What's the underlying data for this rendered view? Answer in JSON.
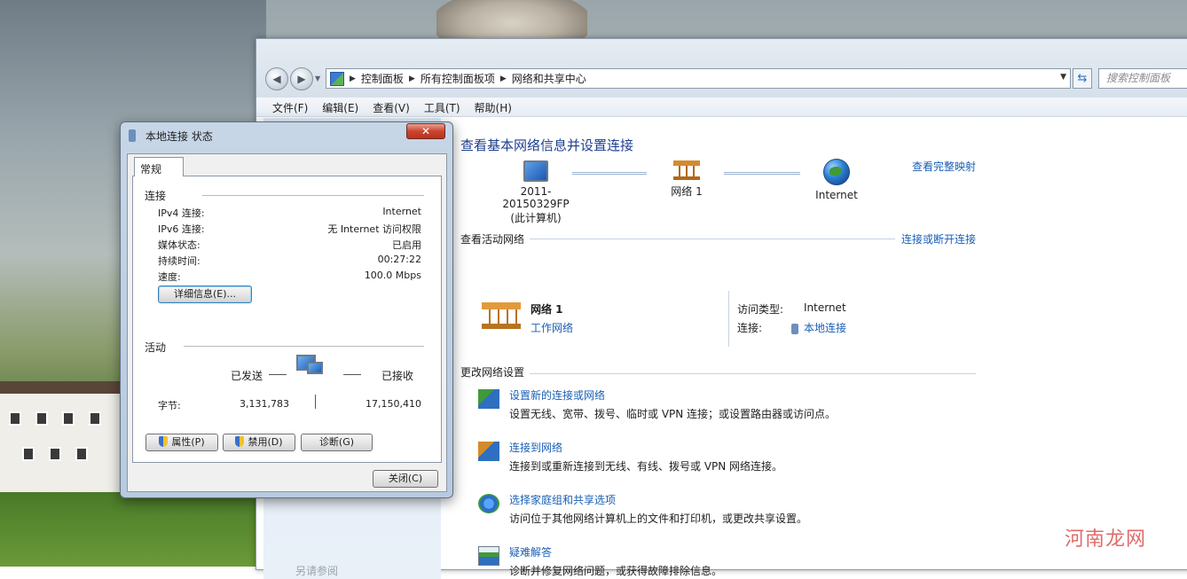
{
  "explorer": {
    "address": {
      "crumbs": [
        "控制面板",
        "所有控制面板项",
        "网络和共享中心"
      ],
      "search_placeholder": "搜索控制面板"
    },
    "menu": [
      "文件(F)",
      "编辑(E)",
      "查看(V)",
      "工具(T)",
      "帮助(H)"
    ],
    "left_pane_bottom": "另请参阅",
    "main": {
      "title": "查看基本网络信息并设置连接",
      "map_link": "查看完整映射",
      "nodes": {
        "computer_name": "2011-20150329FP",
        "computer_sub": "(此计算机)",
        "network": "网络 1",
        "internet": "Internet"
      },
      "active_networks": {
        "heading": "查看活动网络",
        "connect_link": "连接或断开连接",
        "network_name": "网络 1",
        "network_type": "工作网络",
        "access_type_label": "访问类型:",
        "access_type_value": "Internet",
        "connections_label": "连接:",
        "connections_value": "本地连接"
      },
      "change_settings": {
        "heading": "更改网络设置",
        "tasks": [
          {
            "title": "设置新的连接或网络",
            "desc": "设置无线、宽带、拨号、临时或 VPN 连接；或设置路由器或访问点。"
          },
          {
            "title": "连接到网络",
            "desc": "连接到或重新连接到无线、有线、拨号或 VPN 网络连接。"
          },
          {
            "title": "选择家庭组和共享选项",
            "desc": "访问位于其他网络计算机上的文件和打印机，或更改共享设置。"
          },
          {
            "title": "疑难解答",
            "desc": "诊断并修复网络问题，或获得故障排除信息。"
          }
        ]
      }
    }
  },
  "dialog": {
    "title": "本地连接 状态",
    "close_glyph": "✕",
    "tab": "常规",
    "connection": {
      "heading": "连接",
      "rows": [
        {
          "label": "IPv4 连接:",
          "value": "Internet"
        },
        {
          "label": "IPv6 连接:",
          "value": "无 Internet 访问权限"
        },
        {
          "label": "媒体状态:",
          "value": "已启用"
        },
        {
          "label": "持续时间:",
          "value": "00:27:22"
        },
        {
          "label": "速度:",
          "value": "100.0 Mbps"
        }
      ],
      "details_button": "详细信息(E)..."
    },
    "activity": {
      "heading": "活动",
      "sent_label": "已发送",
      "received_label": "已接收",
      "bytes_label": "字节:",
      "bytes_sent": "3,131,783",
      "bytes_received": "17,150,410"
    },
    "buttons": {
      "properties": "属性(P)",
      "disable": "禁用(D)",
      "diagnose": "诊断(G)",
      "close": "关闭(C)"
    }
  },
  "watermark": "河南龙网",
  "colors": {
    "link": "#1a5fb4",
    "title": "#1e3f8f",
    "close_button": "#c9452f"
  }
}
